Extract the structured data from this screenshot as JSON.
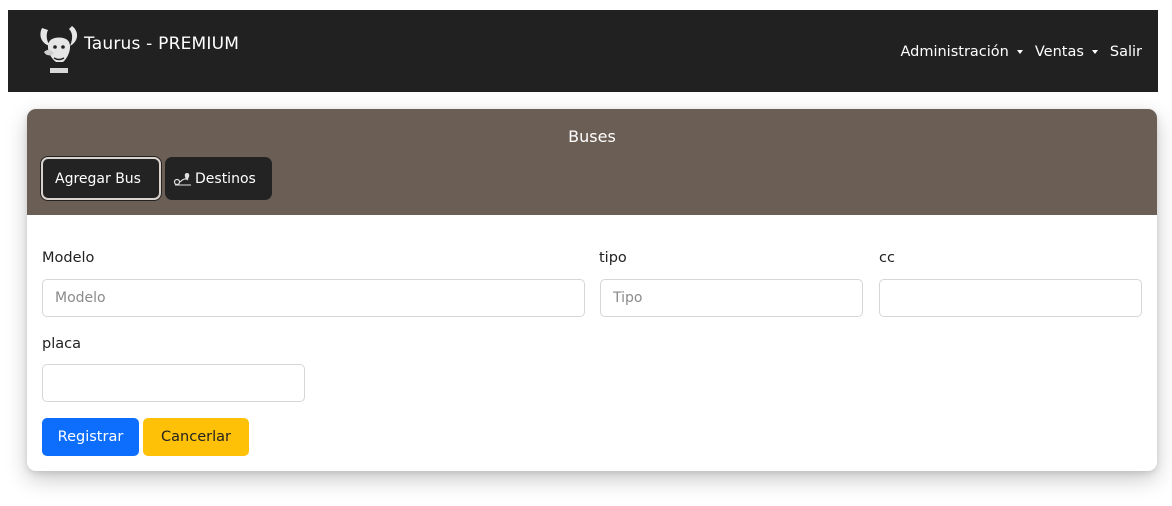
{
  "navbar": {
    "brand": "Taurus - PREMIUM",
    "logo_text": "TAURUS",
    "menu": [
      {
        "label": "Administración",
        "dropdown": true
      },
      {
        "label": "Ventas",
        "dropdown": true
      },
      {
        "label": "Salir",
        "dropdown": false
      }
    ]
  },
  "card": {
    "title": "Buses",
    "buttons": {
      "add": "Agregar Bus",
      "destinations": "Destinos"
    }
  },
  "form": {
    "modelo": {
      "label": "Modelo",
      "placeholder": "Modelo",
      "value": ""
    },
    "tipo": {
      "label": "tipo",
      "placeholder": "Tipo",
      "value": ""
    },
    "cc": {
      "label": "cc",
      "placeholder": "",
      "value": ""
    },
    "placa": {
      "label": "placa",
      "placeholder": "",
      "value": ""
    },
    "submit": "Registrar",
    "cancel": "Cancerlar"
  },
  "colors": {
    "navbar": "#212121",
    "card_header": "#6b5e55",
    "primary": "#0d6efd",
    "warning": "#ffc107"
  }
}
